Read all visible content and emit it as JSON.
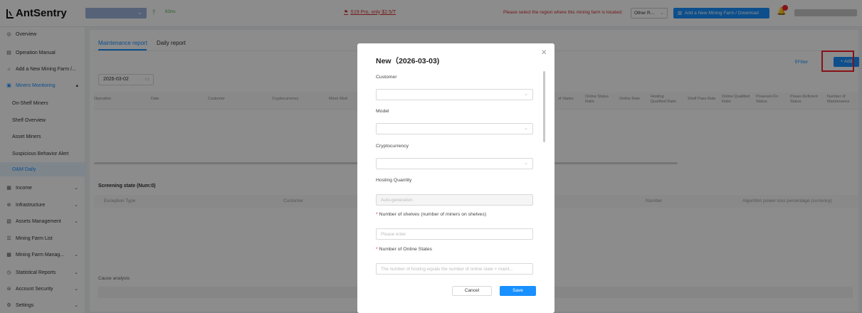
{
  "app": {
    "logo": "AntSentry"
  },
  "header": {
    "latency": "83ms",
    "promo": "S19 Pro, only $2.5/T",
    "region_prompt": "Please select the region where this mining farm is located:",
    "region_value": "Other R...",
    "add_farm_button": "Add a New Mining Farm / Download"
  },
  "sidebar": {
    "items": [
      {
        "label": "Overview",
        "icon": "overview-icon"
      },
      {
        "label": "Operation Manual",
        "icon": "manual-icon"
      },
      {
        "label": "Add a New Mining Farm /...",
        "icon": "farm-icon"
      },
      {
        "label": "Miners Monitoring",
        "icon": "monitor-icon"
      },
      {
        "label": "On-Shelf Miners"
      },
      {
        "label": "Shelf Overview"
      },
      {
        "label": "Asset Miners"
      },
      {
        "label": "Suspicious Behavior Alert"
      },
      {
        "label": "O&M Daily"
      },
      {
        "label": "Income",
        "icon": "income-icon"
      },
      {
        "label": "Infrastructure",
        "icon": "infrastructure-icon"
      },
      {
        "label": "Assets Management",
        "icon": "assets-icon"
      },
      {
        "label": "Mining Farm List",
        "icon": "list-icon"
      },
      {
        "label": "Mining Farm Manag...",
        "icon": "manage-icon"
      },
      {
        "label": "Statistical Reports",
        "icon": "reports-icon"
      },
      {
        "label": "Account Security",
        "icon": "security-icon"
      },
      {
        "label": "Settings",
        "icon": "settings-icon"
      }
    ]
  },
  "main": {
    "tabs": [
      "Maintenance report",
      "Daily report"
    ],
    "date": "2026-03-02",
    "filter_label": "Filter",
    "add_label": "+ Add",
    "columns": [
      "Operation",
      "Date",
      "Customer",
      "Cryptocurrency",
      "Miner Mod",
      "of States",
      "Online Status Ratio",
      "Online Rate",
      "Hosting Qualified Ratio",
      "Shelf Pass Rate",
      "Online Qualified Ratio",
      "Powered-On Status",
      "Power-Deficient Status",
      "Number of Maintenance"
    ],
    "screening_title": "Screening state (Num:0)",
    "screening_columns": [
      "Exception Type",
      "Customer",
      "Number",
      "Algorithm power loss percentage (currency)"
    ],
    "cause_label": "Cause analysis"
  },
  "modal": {
    "title": "New（2026-03-03)",
    "customer_label": "Customer",
    "model_label": "Model",
    "crypto_label": "Cryptocurrency",
    "hosting_label": "Hosting Quantity",
    "hosting_placeholder": "Auto-generation",
    "shelves_label": "Number of shelves (number of miners on shelves)",
    "shelves_placeholder": "Please enter",
    "online_label": "Number of Online States",
    "online_placeholder": "The number of hosting equals the number of online state + maint...",
    "cancel": "Cancel",
    "save": "Save"
  }
}
